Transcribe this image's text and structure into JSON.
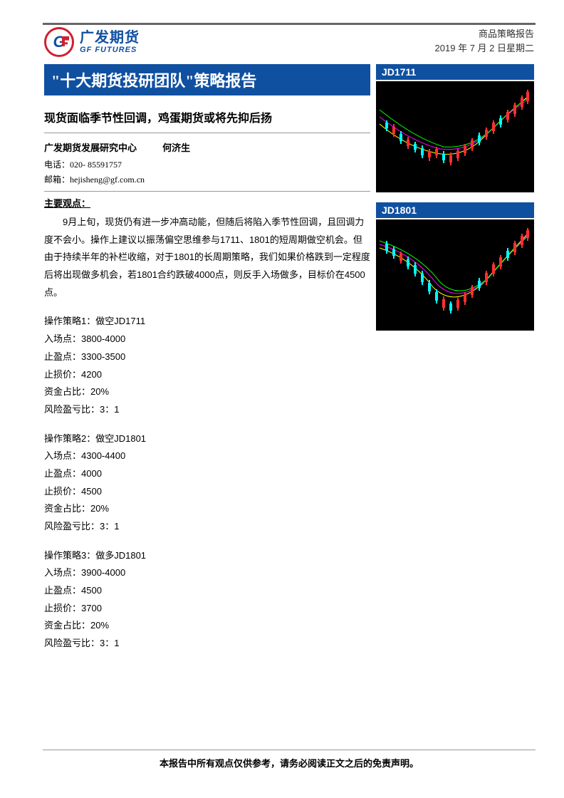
{
  "header": {
    "logo_cn": "广发期货",
    "logo_en": "GF FUTURES",
    "doc_type": "商品策略报告",
    "date": "2019 年 7 月 2 日星期二"
  },
  "title_banner": "\"十大期货投研团队\"策略报告",
  "subtitle": "现货面临季节性回调，鸡蛋期货或将先抑后扬",
  "author_section": {
    "org": "广发期货发展研究中心",
    "author": "何济生",
    "phone_label": "电话：",
    "phone": "020- 85591757",
    "email_label": "邮箱：",
    "email": "hejisheng@gf.com.cn"
  },
  "main_points_label": "主要观点：",
  "main_points_body": "9月上旬，现货仍有进一步冲高动能，但随后将陷入季节性回调，且回调力度不会小。操作上建议以振荡偏空思维参与1711、1801的短周期做空机会。但由于持续半年的补栏收缩，对于1801的长周期策略，我们如果价格跌到一定程度后将出现做多机会，若1801合约跌破4000点，则反手入场做多，目标价在4500点。",
  "strategies": [
    {
      "title": "操作策略1：做空JD1711",
      "entry": "入场点：3800-4000",
      "take_profit": "止盈点：3300-3500",
      "stop_loss": "止损价：4200",
      "capital": "资金占比：20%",
      "risk_reward": "风险盈亏比：3：1"
    },
    {
      "title": "操作策略2：做空JD1801",
      "entry": "入场点：4300-4400",
      "take_profit": "止盈点：4000",
      "stop_loss": "止损价：4500",
      "capital": "资金占比：20%",
      "risk_reward": "风险盈亏比：3：1"
    },
    {
      "title": "操作策略3：做多JD1801",
      "entry": "入场点：3900-4000",
      "take_profit": "止盈点：4500",
      "stop_loss": "止损价：3700",
      "capital": "资金占比：20%",
      "risk_reward": "风险盈亏比：3：1"
    }
  ],
  "charts": [
    {
      "label": "JD1711"
    },
    {
      "label": "JD1801"
    }
  ],
  "footer": "本报告中所有观点仅供参考，请务必阅读正文之后的免责声明。",
  "chart_data": [
    {
      "type": "candlestick",
      "title": "JD1711",
      "note": "Price chart with multiple moving-average overlays; trend declines then rallies strongly to upper right.",
      "series_overlays": [
        "MA-short",
        "MA-mid",
        "MA-long"
      ]
    },
    {
      "type": "candlestick",
      "title": "JD1801",
      "note": "Price chart with multiple moving-average overlays; U-shaped path, dip mid-chart then rally to highs.",
      "series_overlays": [
        "MA-short",
        "MA-mid",
        "MA-long"
      ]
    }
  ]
}
